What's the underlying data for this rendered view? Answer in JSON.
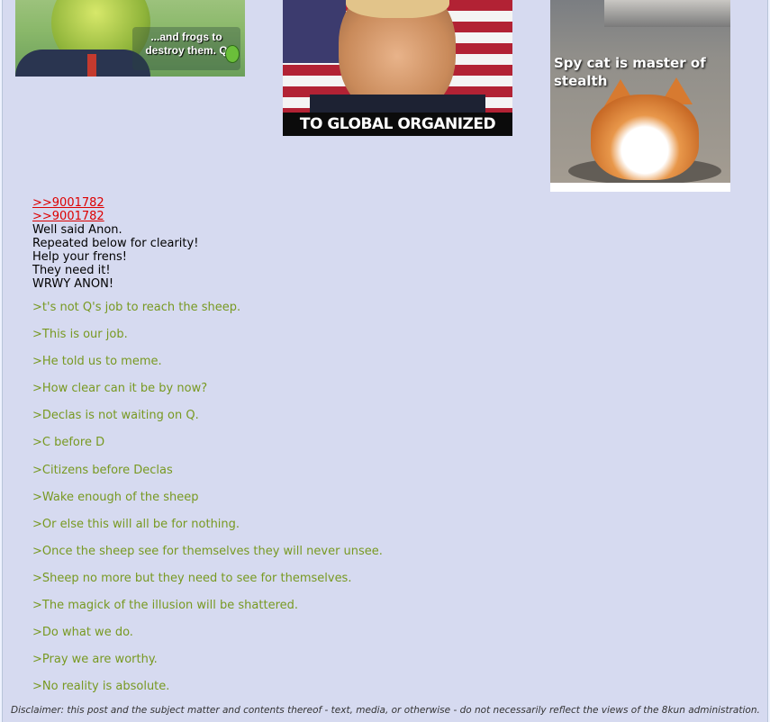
{
  "images": [
    {
      "caption": "...and frogs to destroy them. Q"
    },
    {
      "caption": "TO GLOBAL ORGANIZED CRIME"
    },
    {
      "caption": "Spy cat is master of stealth"
    }
  ],
  "post": {
    "replies": [
      ">>9001782",
      ">>9001782"
    ],
    "lines": [
      "Well said Anon.",
      "Repeated below for clearity!",
      "Help your frens!",
      "They need it!",
      "WRWY ANON!"
    ],
    "quotes": [
      ">t's not Q's job to reach the sheep.",
      ">This is our job.",
      ">He told us to meme.",
      ">How clear can it be by now?",
      ">Declas is not waiting on Q.",
      ">C before D",
      ">Citizens before Declas",
      ">Wake enough of the sheep",
      ">Or else this will all be for nothing.",
      ">Once the sheep see for themselves they will never unsee.",
      ">Sheep no more but they need to see for themselves.",
      ">The magick of the illusion will be shattered.",
      ">Do what we do.",
      ">Pray we are worthy.",
      ">No reality is absolute."
    ]
  },
  "disclaimer": "Disclaimer: this post and the subject matter and contents thereof - text, media, or otherwise - do not necessarily reflect the views of the 8kun administration.",
  "colors": {
    "post_bg": "#d6daf0",
    "reply_link": "#dd0000",
    "greentext": "#789922"
  }
}
